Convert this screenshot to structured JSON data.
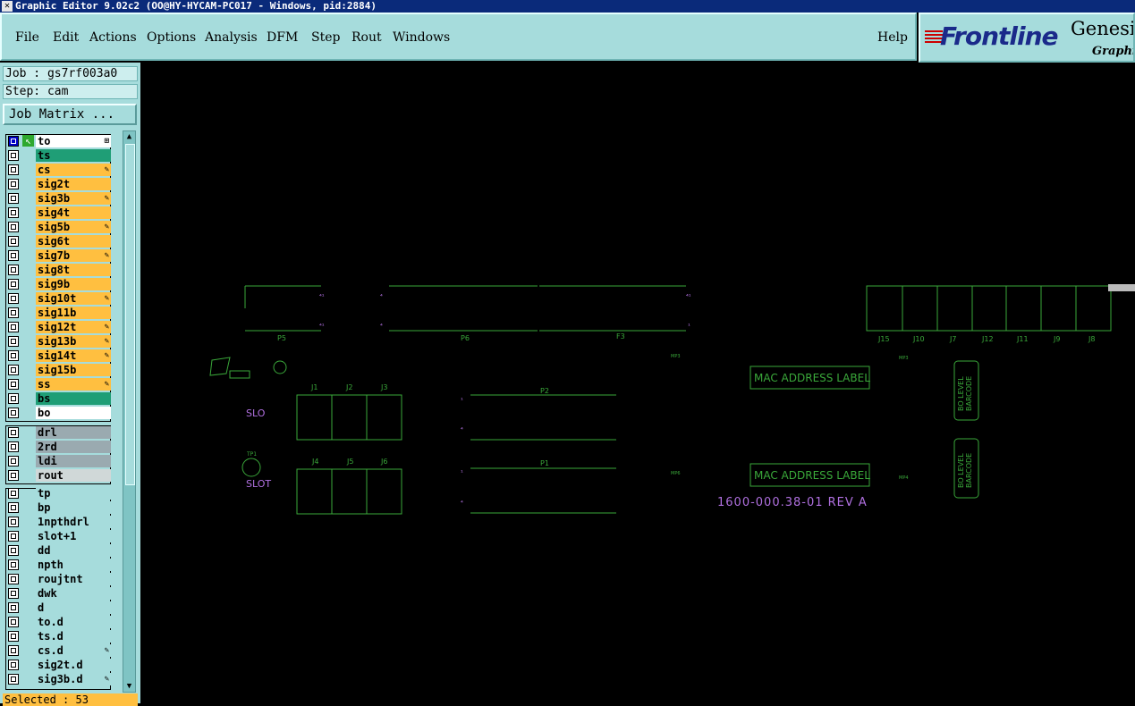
{
  "window": {
    "title": "Graphic Editor 9.02c2 (OO@HY-HYCAM-PC017 - Windows, pid:2884)"
  },
  "menu": {
    "items": [
      "File",
      "Edit",
      "Actions",
      "Options",
      "Analysis",
      "DFM",
      "Step",
      "Rout",
      "Windows"
    ],
    "help": "Help"
  },
  "logo": {
    "brand": "Frontline",
    "product": "Genesi",
    "subtitle": "Graphic"
  },
  "job": {
    "job_line": "Job : gs7rf003a0",
    "step_line": "Step: cam",
    "matrix_button": "Job Matrix ..."
  },
  "layers": {
    "board": [
      {
        "name": "to",
        "color": "#ffffff",
        "active": true,
        "flag": "⊞"
      },
      {
        "name": "ts",
        "color": "#1f9e76",
        "active": false,
        "flag": ""
      },
      {
        "name": "cs",
        "color": "#ffbf40",
        "active": false,
        "flag": "✎"
      },
      {
        "name": "sig2t",
        "color": "#ffbf40",
        "active": false,
        "flag": ""
      },
      {
        "name": "sig3b",
        "color": "#ffbf40",
        "active": false,
        "flag": "✎"
      },
      {
        "name": "sig4t",
        "color": "#ffbf40",
        "active": false,
        "flag": ""
      },
      {
        "name": "sig5b",
        "color": "#ffbf40",
        "active": false,
        "flag": "✎"
      },
      {
        "name": "sig6t",
        "color": "#ffbf40",
        "active": false,
        "flag": ""
      },
      {
        "name": "sig7b",
        "color": "#ffbf40",
        "active": false,
        "flag": "✎"
      },
      {
        "name": "sig8t",
        "color": "#ffbf40",
        "active": false,
        "flag": ""
      },
      {
        "name": "sig9b",
        "color": "#ffbf40",
        "active": false,
        "flag": ""
      },
      {
        "name": "sig10t",
        "color": "#ffbf40",
        "active": false,
        "flag": "✎"
      },
      {
        "name": "sig11b",
        "color": "#ffbf40",
        "active": false,
        "flag": ""
      },
      {
        "name": "sig12t",
        "color": "#ffbf40",
        "active": false,
        "flag": "✎"
      },
      {
        "name": "sig13b",
        "color": "#ffbf40",
        "active": false,
        "flag": "✎"
      },
      {
        "name": "sig14t",
        "color": "#ffbf40",
        "active": false,
        "flag": "✎"
      },
      {
        "name": "sig15b",
        "color": "#ffbf40",
        "active": false,
        "flag": ""
      },
      {
        "name": "ss",
        "color": "#ffbf40",
        "active": false,
        "flag": "✎"
      },
      {
        "name": "bs",
        "color": "#1f9e76",
        "active": false,
        "flag": ""
      },
      {
        "name": "bo",
        "color": "#ffffff",
        "active": false,
        "flag": ""
      }
    ],
    "drill": [
      {
        "name": "drl",
        "color": "#9aaab0",
        "active": false,
        "flag": ""
      },
      {
        "name": "2rd",
        "color": "#9aaab0",
        "active": false,
        "flag": ""
      },
      {
        "name": "ldi",
        "color": "#9aaab0",
        "active": false,
        "flag": ""
      },
      {
        "name": "rout",
        "color": "#d0d8d8",
        "active": false,
        "flag": ""
      }
    ],
    "misc": [
      {
        "name": "tp",
        "color": "#a6dcdc",
        "active": false,
        "flag": ""
      },
      {
        "name": "bp",
        "color": "#a6dcdc",
        "active": false,
        "flag": ""
      },
      {
        "name": "1npthdrl",
        "color": "#a6dcdc",
        "active": false,
        "flag": ""
      },
      {
        "name": "slot+1",
        "color": "#a6dcdc",
        "active": false,
        "flag": ""
      },
      {
        "name": "dd",
        "color": "#a6dcdc",
        "active": false,
        "flag": ""
      },
      {
        "name": "npth",
        "color": "#a6dcdc",
        "active": false,
        "flag": ""
      },
      {
        "name": "roujtnt",
        "color": "#a6dcdc",
        "active": false,
        "flag": ""
      },
      {
        "name": "dwk",
        "color": "#a6dcdc",
        "active": false,
        "flag": ""
      },
      {
        "name": "d",
        "color": "#a6dcdc",
        "active": false,
        "flag": ""
      },
      {
        "name": "to.d",
        "color": "#a6dcdc",
        "active": false,
        "flag": ""
      },
      {
        "name": "ts.d",
        "color": "#a6dcdc",
        "active": false,
        "flag": ""
      },
      {
        "name": "cs.d",
        "color": "#a6dcdc",
        "active": false,
        "flag": "✎"
      },
      {
        "name": "sig2t.d",
        "color": "#a6dcdc",
        "active": false,
        "flag": ""
      },
      {
        "name": "sig3b.d",
        "color": "#a6dcdc",
        "active": false,
        "flag": "✎"
      }
    ]
  },
  "status": {
    "selected": "Selected : 53"
  },
  "canvas": {
    "line_color": "#3aa83a",
    "text_color": "#b070e0",
    "labels": {
      "p5": "P5",
      "p6": "P6",
      "f3": "F3",
      "j15": "J15",
      "j10": "J10",
      "j7": "J7",
      "j12": "J12",
      "j11": "J11",
      "j9": "J9",
      "j8": "J8",
      "j1": "J1",
      "j2": "J2",
      "j3": "J3",
      "j4": "J4",
      "j5": "J5",
      "j6": "J6",
      "p2": "P2",
      "p1": "P1",
      "tp1": "TP1",
      "mac1": "MAC ADDRESS LABEL",
      "mac2": "MAC ADDRESS LABEL",
      "slot1": "SLO",
      "slot2": "SLOT",
      "barcode_a1": "BO LEVEL",
      "barcode_a2": "BARCODE",
      "barcode_b1": "BO LEVEL",
      "barcode_b2": "BARCODE",
      "part": "1600-000.38-01 REV A",
      "mp3a": "MP3",
      "mp3b": "MP3",
      "mp6": "MP6",
      "mp4": "MP4"
    }
  }
}
